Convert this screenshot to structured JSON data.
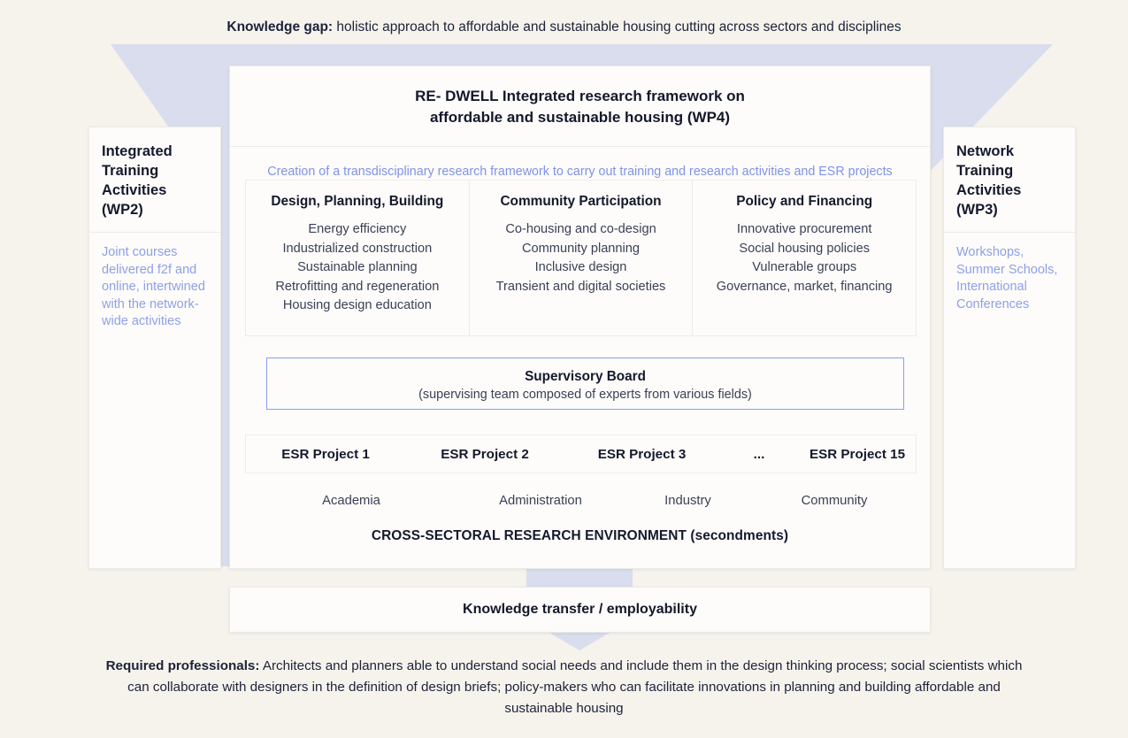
{
  "page": {
    "background_color": "#f6f3ed",
    "accent_blue": "#7f93e6",
    "arrow_color": "#d7dcec",
    "text_color": "#1c2238"
  },
  "knowledge_gap": {
    "lead": "Knowledge gap:",
    "text": " holistic approach to affordable and sustainable housing cutting across sectors and disciplines"
  },
  "framework": {
    "title_line1": "RE- DWELL Integrated research framework on",
    "title_line2": "affordable and sustainable housing (WP4)",
    "subtitle": "Creation of a transdisciplinary research framework to carry out training and research activities and ESR projects"
  },
  "side_left": {
    "heading": "Integrated Training Activities (WP2)",
    "body": "Joint courses delivered f2f and online, intertwined with the network-wide activities"
  },
  "side_right": {
    "heading": "Network Training Activities (WP3)",
    "body": "Workshops, Summer Schools, International Conferences"
  },
  "pillars": [
    {
      "title": "Design, Planning, Building",
      "items": [
        "Energy efficiency",
        "Industrialized construction",
        "Sustainable planning",
        "Retrofitting and regeneration",
        "Housing design education"
      ]
    },
    {
      "title": "Community Participation",
      "items": [
        "Co-housing and co-design",
        "Community planning",
        "Inclusive design",
        "Transient and digital societies"
      ]
    },
    {
      "title": "Policy and Financing",
      "items": [
        "Innovative procurement",
        "Social housing policies",
        "Vulnerable groups",
        "Governance, market, financing"
      ]
    }
  ],
  "supervisory_board": {
    "title": "Supervisory Board",
    "subtitle": "(supervising team composed of experts from various fields)",
    "border_color": "#8ba0f0"
  },
  "esr_projects": [
    "ESR Project 1",
    "ESR Project 2",
    "ESR Project 3",
    "...",
    "ESR Project 15"
  ],
  "sectors": [
    "Academia",
    "Administration",
    "Industry",
    "Community"
  ],
  "cross_sectoral": "CROSS-SECTORAL RESEARCH ENVIRONMENT (secondments)",
  "knowledge_transfer": "Knowledge transfer / employability",
  "required_professionals": {
    "lead": "Required professionals:",
    "text": " Architects and planners able to understand social needs and include them in the design thinking process; social scientists which can collaborate with designers in the definition of design briefs; policy-makers who can facilitate innovations in planning and building affordable and sustainable housing"
  }
}
